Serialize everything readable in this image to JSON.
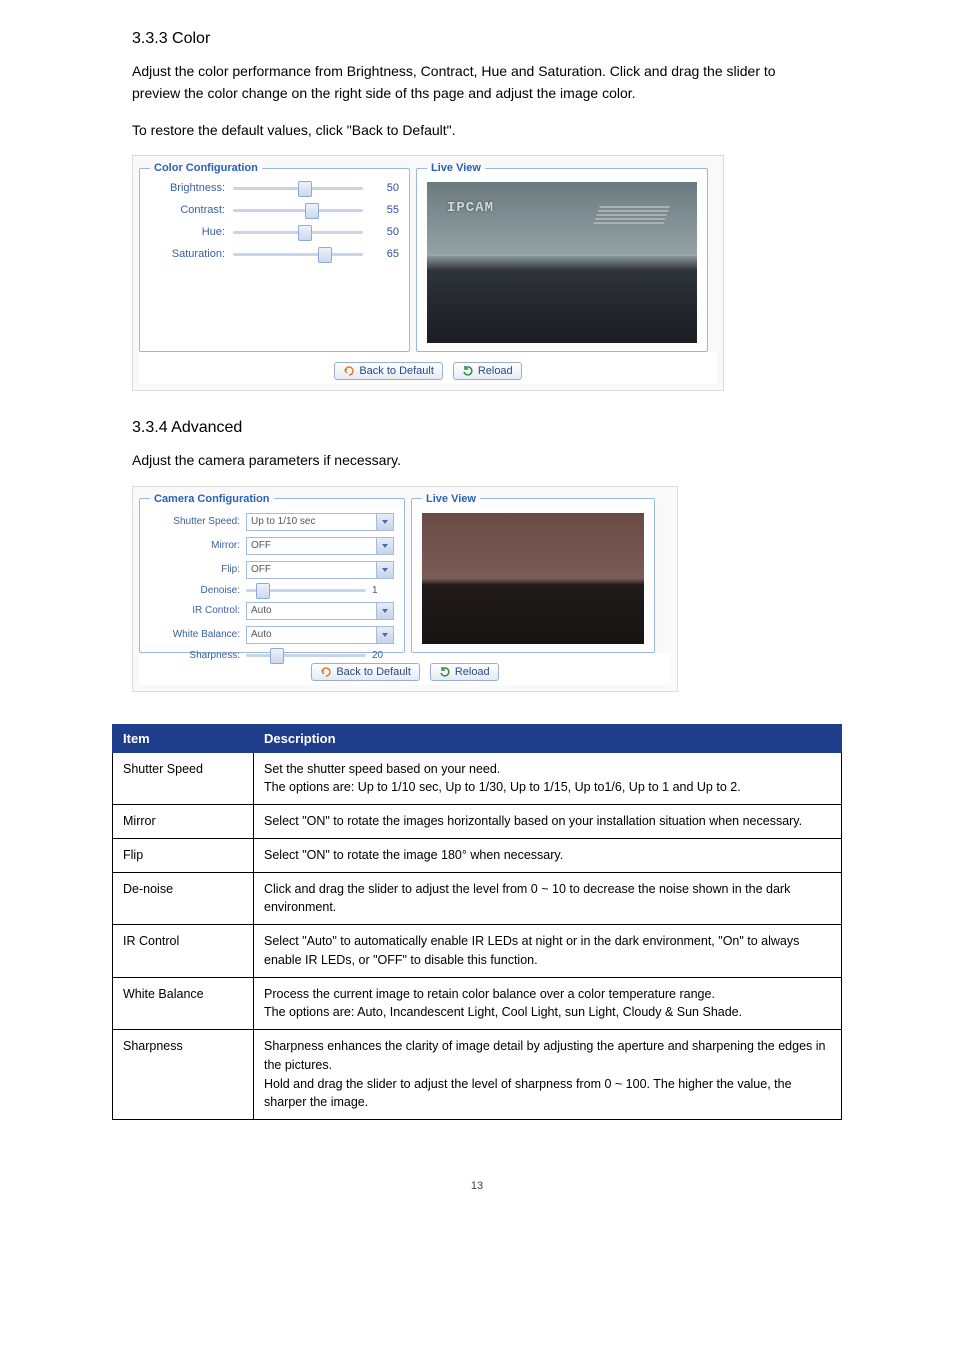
{
  "section_color": {
    "heading": "3.3.3 Color",
    "para1": "Adjust the color performance from Brightness, Contract, Hue and Saturation. Click and drag the slider to preview the color change on the right side of ths page and adjust the image color.",
    "para2": "To restore the default values, click \"Back to Default\".",
    "panel": {
      "config_legend": "Color Configuration",
      "liveview_legend": "Live View",
      "rows": [
        {
          "label": "Brightness:",
          "value": "50",
          "pos": 50
        },
        {
          "label": "Contrast:",
          "value": "55",
          "pos": 55
        },
        {
          "label": "Hue:",
          "value": "50",
          "pos": 50
        },
        {
          "label": "Saturation:",
          "value": "65",
          "pos": 65
        }
      ],
      "ipcam_label": "IPCAM",
      "btn_back": "Back to Default",
      "btn_reload": "Reload"
    }
  },
  "section_advanced": {
    "heading": "3.3.4 Advanced",
    "para1": "Adjust the camera parameters if necessary.",
    "panel": {
      "config_legend": "Camera Configuration",
      "liveview_legend": "Live View",
      "rows": [
        {
          "label": "Shutter Speed:",
          "type": "combo",
          "value": "Up to 1/10 sec"
        },
        {
          "label": "Mirror:",
          "type": "combo",
          "value": "OFF"
        },
        {
          "label": "Flip:",
          "type": "combo",
          "value": "OFF"
        },
        {
          "label": "Denoise:",
          "type": "slider",
          "value": "1",
          "pos": 10
        },
        {
          "label": "IR Control:",
          "type": "combo",
          "value": "Auto"
        },
        {
          "label": "White Balance:",
          "type": "combo",
          "value": "Auto"
        },
        {
          "label": "Sharpness:",
          "type": "slider",
          "value": "20",
          "pos": 20
        }
      ],
      "btn_back": "Back to Default",
      "btn_reload": "Reload"
    }
  },
  "table": {
    "headers": [
      "Item",
      "Description"
    ],
    "rows": [
      {
        "item": "Shutter Speed",
        "desc": "Set the shutter speed based on your need.\nThe options are: Up to 1/10 sec, Up to 1/30, Up to 1/15, Up to1/6, Up to 1 and Up to 2."
      },
      {
        "item": "Mirror",
        "desc": "Select \"ON\" to rotate the images horizontally based on your installation situation when necessary."
      },
      {
        "item": "Flip",
        "desc": "Select \"ON\" to rotate the image 180° when necessary."
      },
      {
        "item": "De-noise",
        "desc": "Click and drag the slider to adjust the level from 0 ~ 10 to decrease the noise shown in the dark environment."
      },
      {
        "item": "IR Control",
        "desc": "Select \"Auto\" to automatically enable IR LEDs at night or in the dark environment, \"On\" to always enable IR LEDs, or \"OFF\" to disable this function."
      },
      {
        "item": "White Balance",
        "desc": "Process the current image to retain color balance over a color temperature range.\nThe options are: Auto, Incandescent Light, Cool Light, sun Light, Cloudy & Sun Shade."
      },
      {
        "item": "Sharpness",
        "desc": "Sharpness enhances the clarity of image detail by adjusting the aperture and sharpening the edges in the pictures.\nHold and drag the slider to adjust the level of sharpness from 0 ~ 100. The higher the value, the sharper the image."
      }
    ]
  },
  "page_number": "13"
}
